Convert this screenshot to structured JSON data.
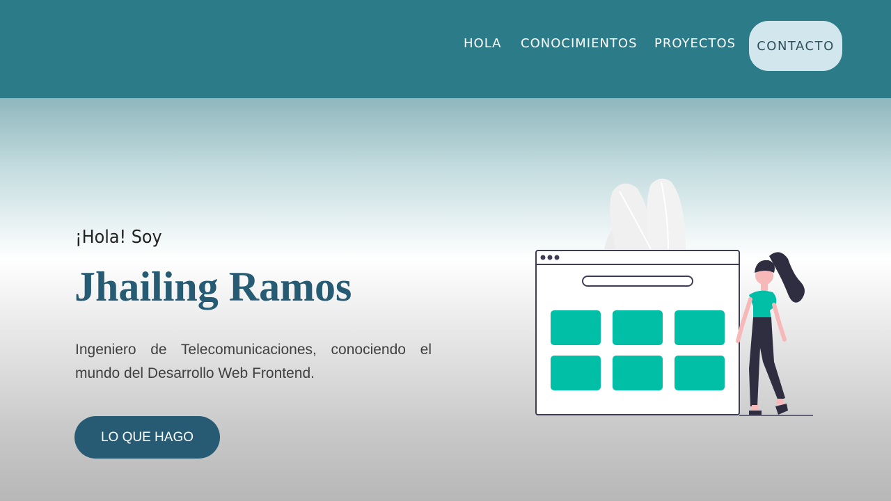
{
  "nav": {
    "links": [
      "HOLA",
      "CONOCIMIENTOS",
      "PROYECTOS"
    ],
    "contact_label": "CONTACTO"
  },
  "hero": {
    "greeting": "¡Hola! Soy",
    "name": "Jhailing Ramos",
    "description": "Ingeniero de Telecomunicaciones, conociendo el mundo del Desarrollo Web Frontend.",
    "cta_label": "LO QUE HAGO"
  },
  "colors": {
    "navbar": "#2c7b89",
    "name_text": "#265b73",
    "cta_button": "#265b73",
    "contact_button": "#d2e6ee",
    "illustration_accent": "#00bfa6"
  },
  "icons": [
    "web-page-illustration",
    "woman-illustration",
    "leaf-decoration"
  ]
}
